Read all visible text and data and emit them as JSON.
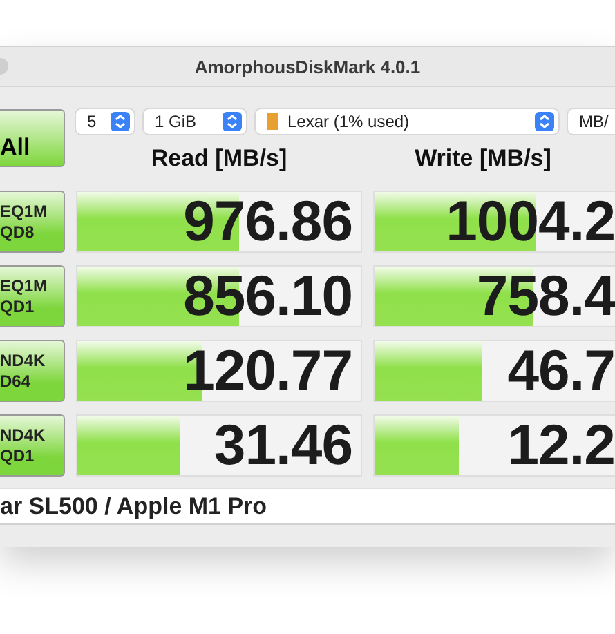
{
  "window": {
    "title": "AmorphousDiskMark 4.0.1"
  },
  "all_button": "All",
  "selects": [
    {
      "kind": "plain",
      "value": "5"
    },
    {
      "kind": "plain",
      "value": "1 GiB"
    },
    {
      "kind": "drive",
      "value": "Lexar (1% used)"
    },
    {
      "kind": "cut",
      "value": "MB/"
    }
  ],
  "headers": [
    "Read [MB/s]",
    "Write [MB/s]"
  ],
  "rows": [
    {
      "label": [
        "EQ1M",
        "QD8"
      ],
      "read": {
        "value": "976.86",
        "level": 0.57
      },
      "write": {
        "value": "1004.2",
        "level": 0.67
      }
    },
    {
      "label": [
        "EQ1M",
        "QD1"
      ],
      "read": {
        "value": "856.10",
        "level": 0.57
      },
      "write": {
        "value": "758.4",
        "level": 0.66
      }
    },
    {
      "label": [
        "ND4K",
        "D64"
      ],
      "read": {
        "value": "120.77",
        "level": 0.44
      },
      "write": {
        "value": "46.7",
        "level": 0.45
      }
    },
    {
      "label": [
        "ND4K",
        "QD1"
      ],
      "read": {
        "value": "31.46",
        "level": 0.36
      },
      "write": {
        "value": "12.2",
        "level": 0.35
      }
    }
  ],
  "footer": {
    "value": "ar SL500 / Apple M1 Pro"
  }
}
